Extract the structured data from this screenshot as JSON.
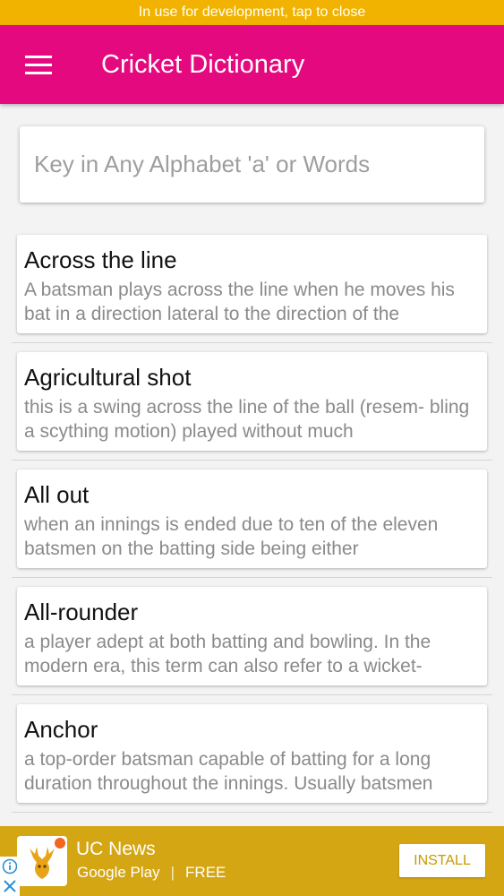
{
  "dev_banner": "In use for development, tap to close",
  "app": {
    "title": "Cricket Dictionary"
  },
  "search": {
    "placeholder": "Key in Any Alphabet 'a' or Words"
  },
  "entries": [
    {
      "term": "Across the line",
      "definition": "A batsman plays across the line when he moves his bat in a direction lateral to the direction of the"
    },
    {
      "term": "Agricultural shot",
      "definition": "this is a swing across the line of the ball (resem- bling a scything motion) played without much"
    },
    {
      "term": "All out",
      "definition": "when an innings is ended due to ten of the eleven batsmen on the batting side being either"
    },
    {
      "term": "All-rounder",
      "definition": "a player adept at both batting and bowling. In the modern era, this term can also refer to a wicket-"
    },
    {
      "term": "Anchor",
      "definition": "a top-order batsman capable of batting for a long duration throughout the innings. Usually batsmen"
    }
  ],
  "ad": {
    "name": "UC News",
    "store": "Google Play",
    "price": "FREE",
    "install_label": "INSTALL"
  },
  "colors": {
    "appbar": "#e5097f",
    "banner": "#f2b300",
    "ad_background": "#d4a614"
  }
}
